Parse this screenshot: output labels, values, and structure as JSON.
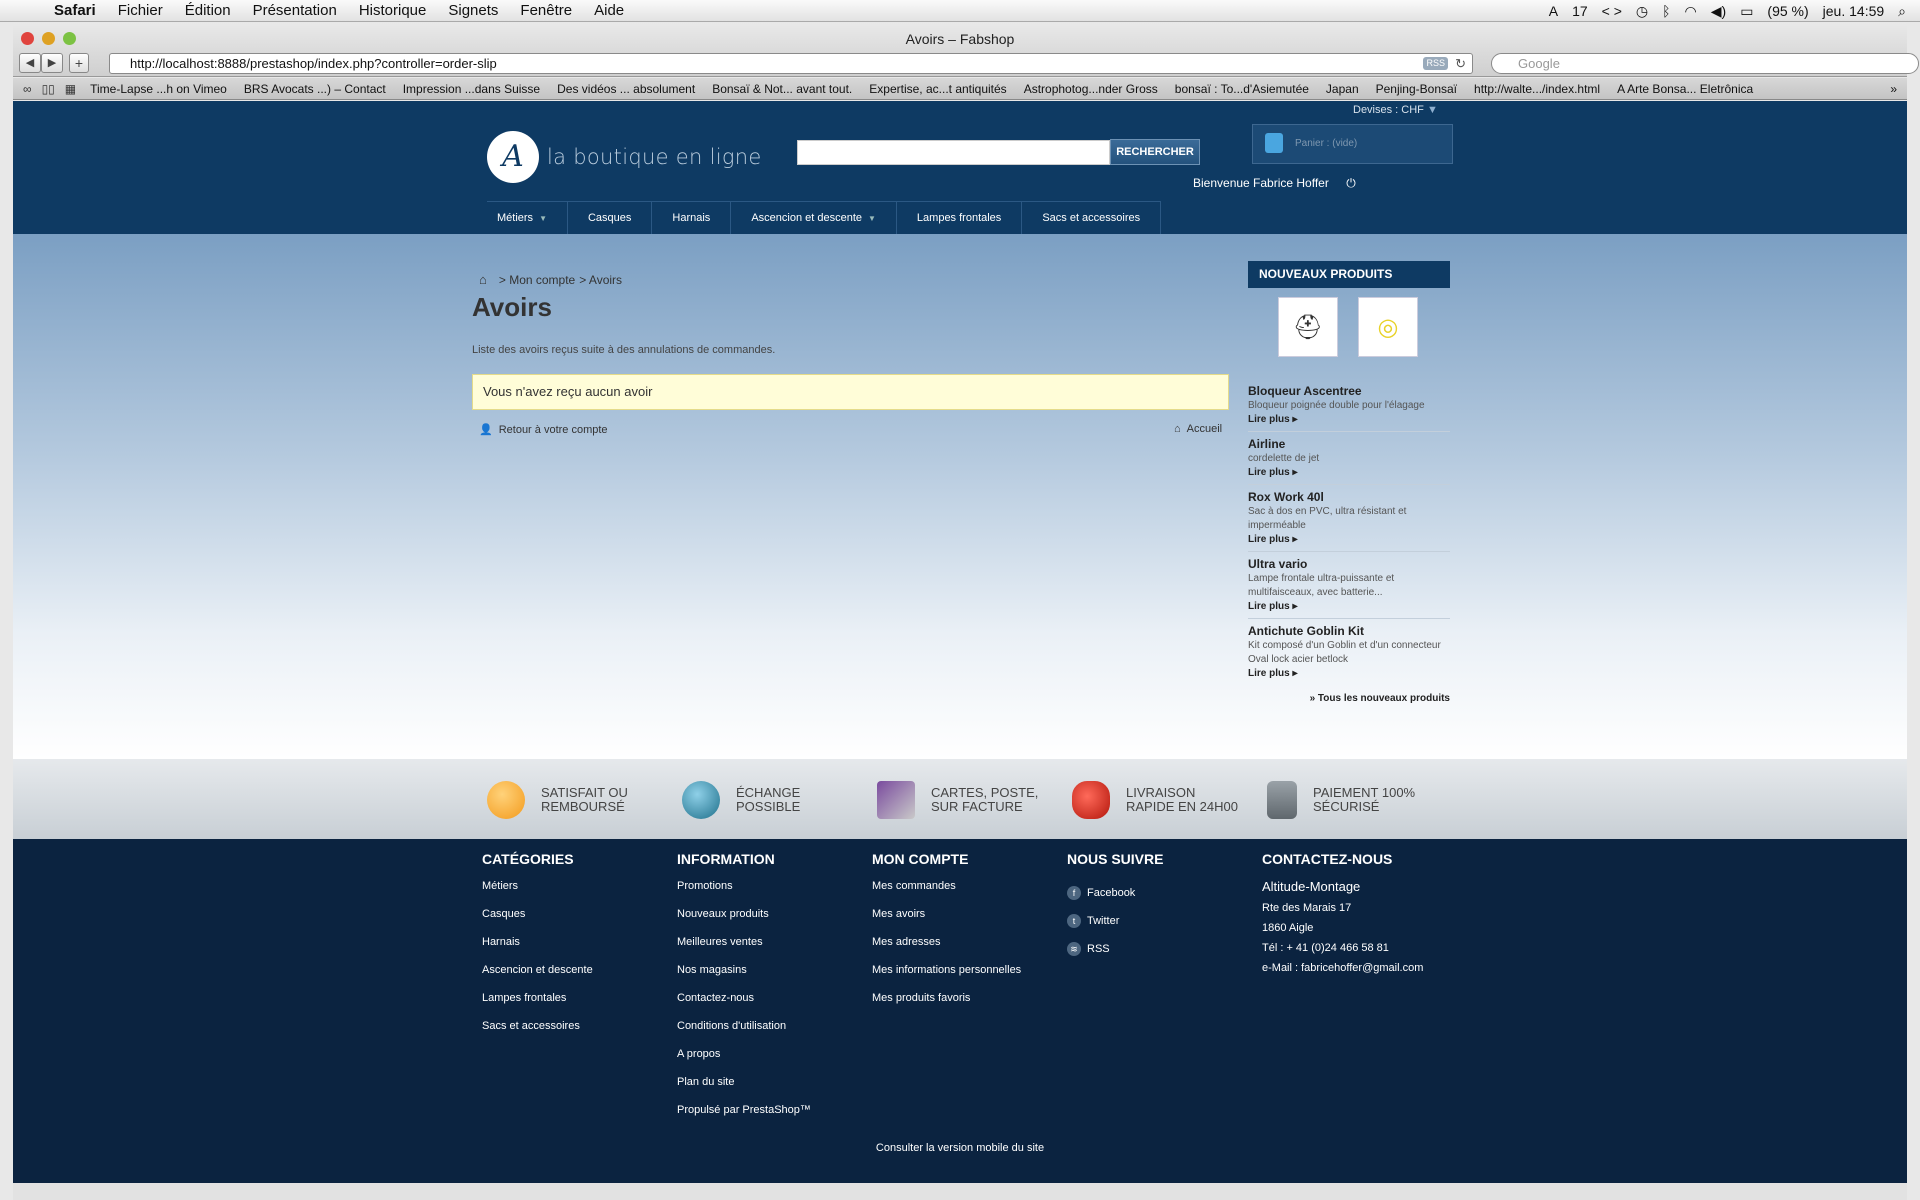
{
  "menubar": {
    "app": "Safari",
    "items": [
      "Fichier",
      "Édition",
      "Présentation",
      "Historique",
      "Signets",
      "Fenêtre",
      "Aide"
    ],
    "status_count": "17",
    "battery": "(95 %)",
    "clock": "jeu. 14:59"
  },
  "browser": {
    "window_title": "Avoirs – Fabshop",
    "url": "http://localhost:8888/prestashop/index.php?controller=order-slip",
    "rss": "RSS",
    "search_placeholder": "Google",
    "bookmarks": [
      "Time-Lapse ...h on Vimeo",
      "BRS Avocats ...) – Contact",
      "Impression ...dans Suisse",
      "Des vidéos ... absolument",
      "Bonsaï & Not... avant tout.",
      "Expertise, ac...t antiquités",
      "Astrophotog...nder Gross",
      "bonsaï : To...d'Asiemutée",
      "Japan",
      "Penjing-Bonsaï",
      "http://walte.../index.html",
      "A Arte Bonsa... Eletrônica"
    ]
  },
  "header": {
    "devises": "Devises : CHF",
    "logo_text": "la boutique en ligne",
    "search_button": "RECHERCHER",
    "cart": "Panier : (vide)",
    "welcome": "Bienvenue Fabrice Hoffer",
    "nav": [
      "Métiers",
      "Casques",
      "Harnais",
      "Ascencion et descente",
      "Lampes frontales",
      "Sacs et accessoires"
    ]
  },
  "main": {
    "breadcrumb_1": "> Mon compte",
    "breadcrumb_2": "> Avoirs",
    "title": "Avoirs",
    "intro": "Liste des avoirs reçus suite à des annulations de commandes.",
    "alert": "Vous n'avez reçu aucun avoir",
    "back_link": "Retour à votre compte",
    "home_link": "Accueil"
  },
  "sidebar": {
    "heading": "NOUVEAUX PRODUITS",
    "products": [
      {
        "name": "Bloqueur Ascentree",
        "desc": "Bloqueur poignée double pour l'élagage",
        "more": "Lire plus"
      },
      {
        "name": "Airline",
        "desc": "cordelette de jet",
        "more": "Lire plus"
      },
      {
        "name": "Rox Work 40l",
        "desc": "Sac à dos en PVC, ultra résistant et imperméable",
        "more": "Lire plus"
      },
      {
        "name": "Ultra vario",
        "desc": "Lampe frontale ultra-puissante et multifaisceaux, avec batterie...",
        "more": "Lire plus"
      },
      {
        "name": "Antichute Goblin Kit",
        "desc": "Kit composé d'un Goblin et d'un connecteur Oval lock acier betlock",
        "more": "Lire plus"
      }
    ],
    "all_link": "» Tous les nouveaux produits"
  },
  "reassurance": [
    "SATISFAIT OU REMBOURSÉ",
    "ÉCHANGE POSSIBLE",
    "CARTES, POSTE, SUR FACTURE",
    "LIVRAISON RAPIDE EN 24H00",
    "PAIEMENT 100% SÉCURISÉ"
  ],
  "footer": {
    "categories_title": "CATÉGORIES",
    "categories": [
      "Métiers",
      "Casques",
      "Harnais",
      "Ascencion et descente",
      "Lampes frontales",
      "Sacs et accessoires"
    ],
    "information_title": "INFORMATION",
    "information": [
      "Promotions",
      "Nouveaux produits",
      "Meilleures ventes",
      "Nos magasins",
      "Contactez-nous",
      "Conditions d'utilisation",
      "A propos",
      "Plan du site",
      "Propulsé par PrestaShop™"
    ],
    "account_title": "MON COMPTE",
    "account": [
      "Mes commandes",
      "Mes avoirs",
      "Mes adresses",
      "Mes informations personnelles",
      "Mes produits favoris"
    ],
    "follow_title": "NOUS SUIVRE",
    "follow": [
      "Facebook",
      "Twitter",
      "RSS"
    ],
    "contact_title": "CONTACTEZ-NOUS",
    "contact_name": "Altitude-Montage",
    "contact_street": "Rte des Marais 17",
    "contact_city": "1860 Aigle",
    "contact_tel": "Tél : + 41 (0)24 466 58 81",
    "contact_email": "e-Mail : fabricehoffer@gmail.com",
    "mobile": "Consulter la version mobile du site"
  }
}
